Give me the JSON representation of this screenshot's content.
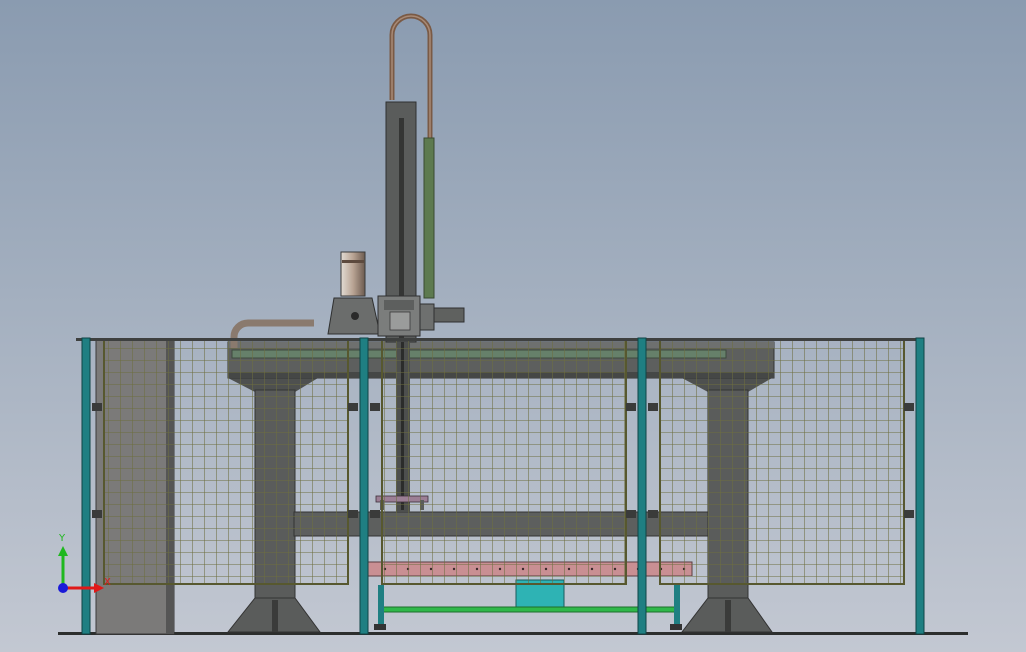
{
  "triad": {
    "y_label": "Y",
    "x_label": "X",
    "y_color": "#1fb81f",
    "x_color": "#e01818",
    "z_color": "#1a1ad8"
  },
  "colors": {
    "bg_top": "#8a9bb0",
    "bg_bottom": "#c3c8d2",
    "steel": "#5d5f5e",
    "steel_dark": "#3e403f",
    "steel_light": "#7b7d7c",
    "fence_post": "#1f7f82",
    "mesh": "#6d6e3f",
    "rail_green": "#2fb84a",
    "panel_cyan": "#2eb3b4",
    "beam_pink": "#c98f93",
    "cable_brown": "#7a5a45"
  }
}
